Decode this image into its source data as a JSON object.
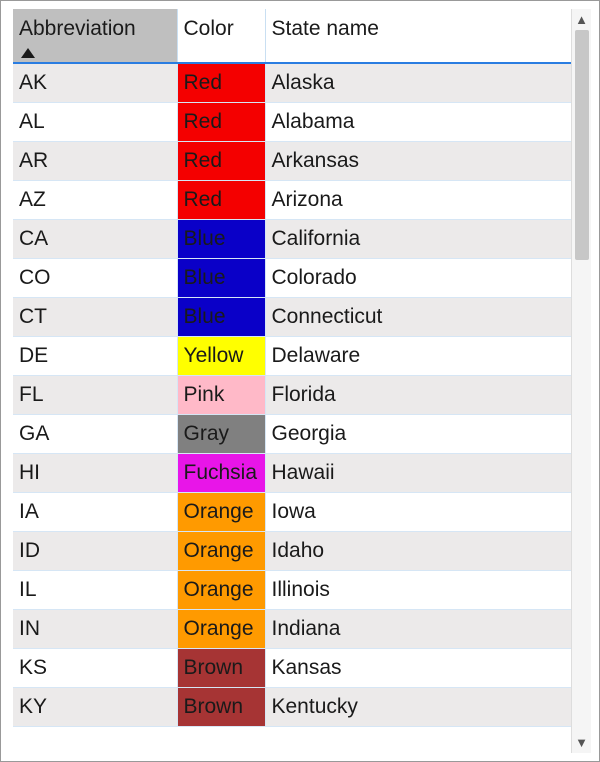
{
  "columns": [
    {
      "id": "abbrev",
      "label": "Abbreviation",
      "sorted": "asc"
    },
    {
      "id": "color",
      "label": "Color"
    },
    {
      "id": "state",
      "label": "State name"
    }
  ],
  "colorMap": {
    "Red": "#f40000",
    "Blue": "#0a00c8",
    "Yellow": "#ffff00",
    "Pink": "#ffb9c8",
    "Gray": "#808080",
    "Fuchsia": "#e815e8",
    "Orange": "#ff9a00",
    "Brown": "#a63434"
  },
  "rows": [
    {
      "abbrev": "AK",
      "color": "Red",
      "state": "Alaska"
    },
    {
      "abbrev": "AL",
      "color": "Red",
      "state": "Alabama"
    },
    {
      "abbrev": "AR",
      "color": "Red",
      "state": "Arkansas"
    },
    {
      "abbrev": "AZ",
      "color": "Red",
      "state": "Arizona"
    },
    {
      "abbrev": "CA",
      "color": "Blue",
      "state": "California"
    },
    {
      "abbrev": "CO",
      "color": "Blue",
      "state": "Colorado"
    },
    {
      "abbrev": "CT",
      "color": "Blue",
      "state": "Connecticut"
    },
    {
      "abbrev": "DE",
      "color": "Yellow",
      "state": "Delaware"
    },
    {
      "abbrev": "FL",
      "color": "Pink",
      "state": "Florida"
    },
    {
      "abbrev": "GA",
      "color": "Gray",
      "state": "Georgia"
    },
    {
      "abbrev": "HI",
      "color": "Fuchsia",
      "state": "Hawaii"
    },
    {
      "abbrev": "IA",
      "color": "Orange",
      "state": "Iowa"
    },
    {
      "abbrev": "ID",
      "color": "Orange",
      "state": "Idaho"
    },
    {
      "abbrev": "IL",
      "color": "Orange",
      "state": "Illinois"
    },
    {
      "abbrev": "IN",
      "color": "Orange",
      "state": "Indiana"
    },
    {
      "abbrev": "KS",
      "color": "Brown",
      "state": "Kansas"
    },
    {
      "abbrev": "KY",
      "color": "Brown",
      "state": "Kentucky"
    }
  ]
}
